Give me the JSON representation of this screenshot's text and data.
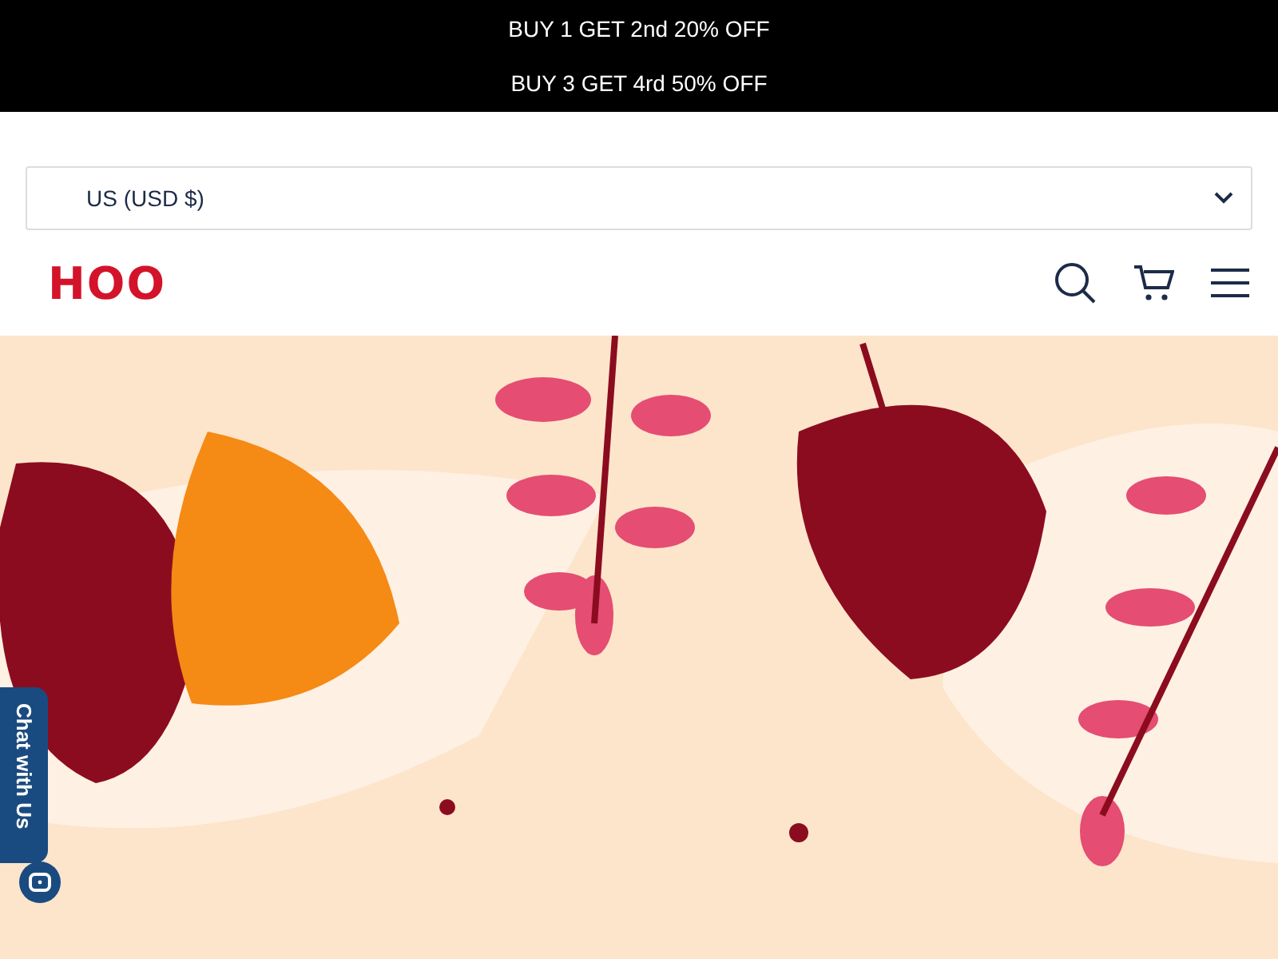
{
  "announcements": [
    "BUY 1 GET 2nd 20% OFF",
    "BUY 3 GET 4rd 50% OFF"
  ],
  "currency_selector": {
    "value": "US (USD $)"
  },
  "header": {
    "logo": "HOO"
  },
  "chat_widget": {
    "label": "Chat with Us"
  }
}
